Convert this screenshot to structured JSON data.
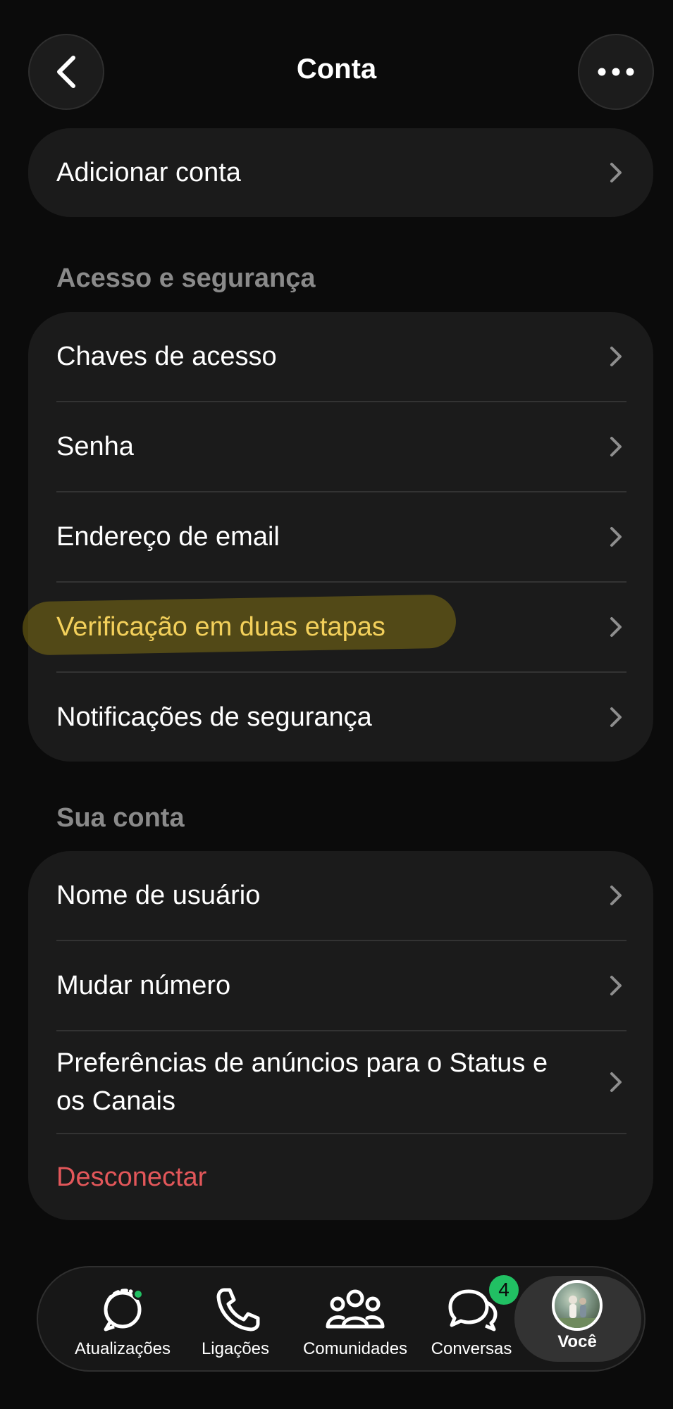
{
  "header": {
    "title": "Conta"
  },
  "top_card": {
    "add_account": "Adicionar conta"
  },
  "access_security": {
    "section_title": "Acesso e segurança",
    "items": [
      "Chaves de acesso",
      "Senha",
      "Endereço de email",
      "Verificação em duas etapas",
      "Notificações de segurança"
    ]
  },
  "your_account": {
    "section_title": "Sua conta",
    "items": [
      "Nome de usuário",
      "Mudar número",
      "Preferências de anúncios para o Status e os Canais"
    ],
    "logout": "Desconectar"
  },
  "tabbar": {
    "tabs": [
      {
        "label": "Atualizações",
        "icon": "status-icon"
      },
      {
        "label": "Ligações",
        "icon": "phone-icon"
      },
      {
        "label": "Comunidades",
        "icon": "communities-icon"
      },
      {
        "label": "Conversas",
        "icon": "chats-icon",
        "badge": "4"
      },
      {
        "label": "Você",
        "icon": "avatar"
      }
    ],
    "active": "Você"
  },
  "colors": {
    "background": "#0b0b0b",
    "card": "#1b1b1b",
    "highlight_text": "#f3d05b",
    "danger": "#e3575a",
    "accent_green": "#21c063"
  }
}
